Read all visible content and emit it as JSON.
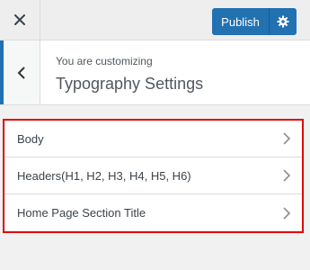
{
  "topbar": {
    "close_icon": "close-icon",
    "publish_label": "Publish",
    "settings_icon": "gear-icon",
    "accent_color": "#2271b1"
  },
  "section": {
    "breadcrumb": "You are customizing",
    "title": "Typography Settings",
    "back_icon": "chevron-left-icon"
  },
  "menu": {
    "items": [
      {
        "label": "Body"
      },
      {
        "label": "Headers(H1, H2, H3, H4, H5, H6)"
      },
      {
        "label": "Home Page Section Title"
      }
    ],
    "highlight_color": "#e10000"
  }
}
